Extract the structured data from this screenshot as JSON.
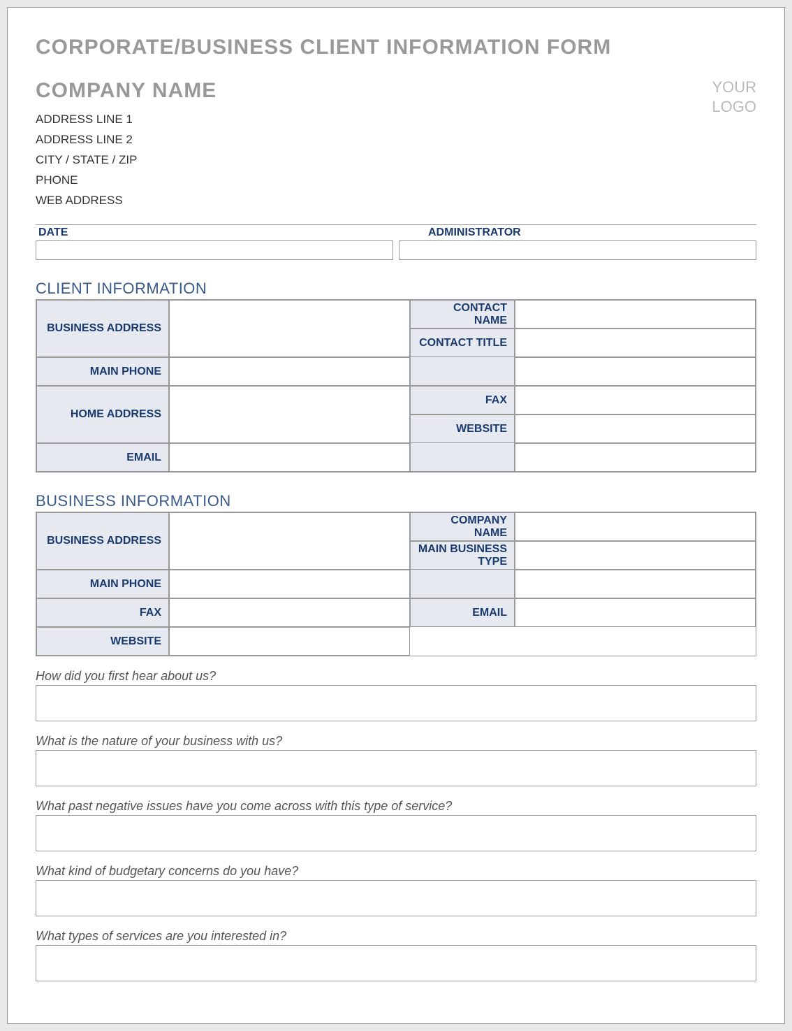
{
  "form_title": "CORPORATE/BUSINESS CLIENT INFORMATION FORM",
  "company": {
    "name": "COMPANY NAME",
    "address1": "ADDRESS LINE 1",
    "address2": "ADDRESS LINE 2",
    "city_state_zip": "CITY / STATE / ZIP",
    "phone": "PHONE",
    "web": "WEB ADDRESS"
  },
  "logo": {
    "line1": "YOUR",
    "line2": "LOGO"
  },
  "date_admin": {
    "date_label": "DATE",
    "admin_label": "ADMINISTRATOR"
  },
  "sections": {
    "client_info_heading": "CLIENT INFORMATION",
    "business_info_heading": "BUSINESS INFORMATION"
  },
  "client_info_labels": {
    "contact_name": "CONTACT NAME",
    "contact_title": "CONTACT TITLE",
    "main_phone": "MAIN PHONE",
    "fax": "FAX",
    "website": "WEBSITE",
    "email": "EMAIL",
    "business_address": "BUSINESS ADDRESS",
    "home_address": "HOME ADDRESS"
  },
  "business_info_labels": {
    "company_name": "COMPANY NAME",
    "main_business_type": "MAIN BUSINESS TYPE",
    "main_phone": "MAIN PHONE",
    "fax": "FAX",
    "website": "WEBSITE",
    "business_address": "BUSINESS ADDRESS",
    "email": "EMAIL"
  },
  "questions": {
    "q1": "How did you first hear about us?",
    "q2": "What is the nature of your business with us?",
    "q3": "What past negative issues have you come across with this type of service?",
    "q4": "What kind of budgetary concerns do you have?",
    "q5": "What types of services are you interested in?"
  }
}
